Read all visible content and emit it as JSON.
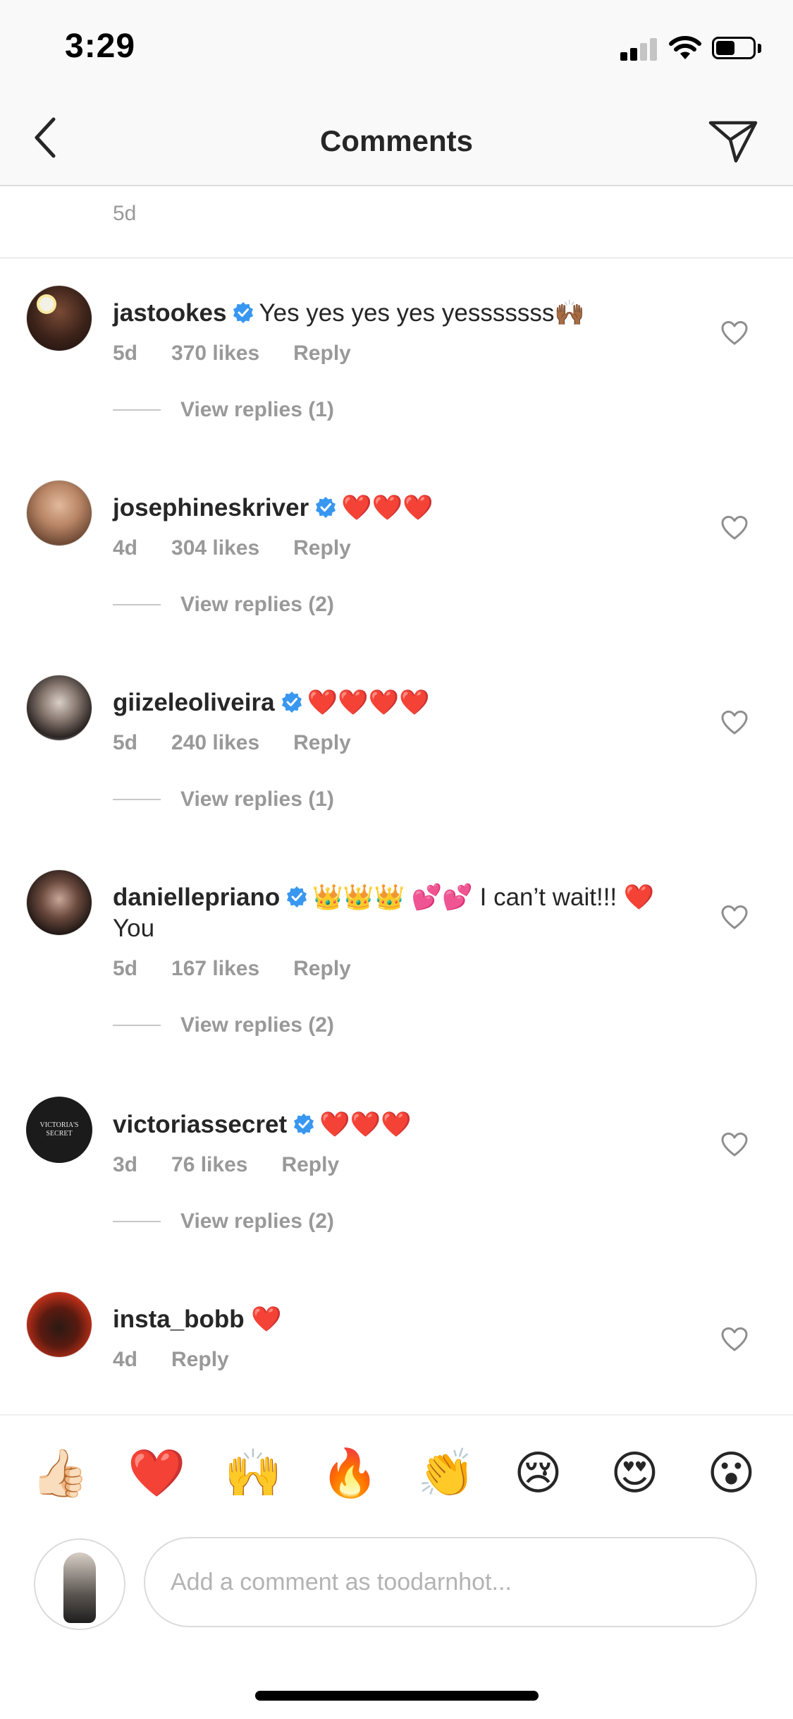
{
  "status_bar": {
    "time": "3:29"
  },
  "nav": {
    "title": "Comments"
  },
  "top_comment": {
    "time": "5d"
  },
  "comments": [
    {
      "username": "jastookes",
      "verified": true,
      "text": "Yes yes yes yes yesssssss🙌🏾",
      "time": "5d",
      "likes": "370 likes",
      "reply": "Reply",
      "view_replies": "View replies (1)"
    },
    {
      "username": "josephineskriver",
      "verified": true,
      "text": "❤️❤️❤️",
      "time": "4d",
      "likes": "304 likes",
      "reply": "Reply",
      "view_replies": "View replies (2)"
    },
    {
      "username": "giizeleoliveira",
      "verified": true,
      "text": "❤️❤️❤️❤️",
      "time": "5d",
      "likes": "240 likes",
      "reply": "Reply",
      "view_replies": "View replies (1)"
    },
    {
      "username": "daniellepriano",
      "verified": true,
      "text": "👑👑👑 💕💕 I can’t wait!!! ❤️ You",
      "time": "5d",
      "likes": "167 likes",
      "reply": "Reply",
      "view_replies": "View replies (2)"
    },
    {
      "username": "victoriassecret",
      "verified": true,
      "text": "❤️❤️❤️",
      "time": "3d",
      "likes": "76 likes",
      "reply": "Reply",
      "view_replies": "View replies (2)",
      "avatar_text": "VICTORIA'S SECRET"
    },
    {
      "username": "insta_bobb",
      "verified": false,
      "text": "❤️",
      "time": "4d",
      "reply": "Reply"
    }
  ],
  "emoji_bar": [
    "👍🏻",
    "❤️",
    "🙌",
    "🔥",
    "👏",
    "😢",
    "😍",
    "😮"
  ],
  "composer": {
    "placeholder": "Add a comment as toodarnhot..."
  },
  "colors": {
    "text": "#262626",
    "meta": "#999999",
    "verified": "#3897f0",
    "divider": "#dbdbdb"
  },
  "icons": {
    "back": "chevron-left-icon",
    "direct": "paper-plane-icon",
    "like": "heart-outline-icon",
    "verified": "verified-badge-icon"
  }
}
